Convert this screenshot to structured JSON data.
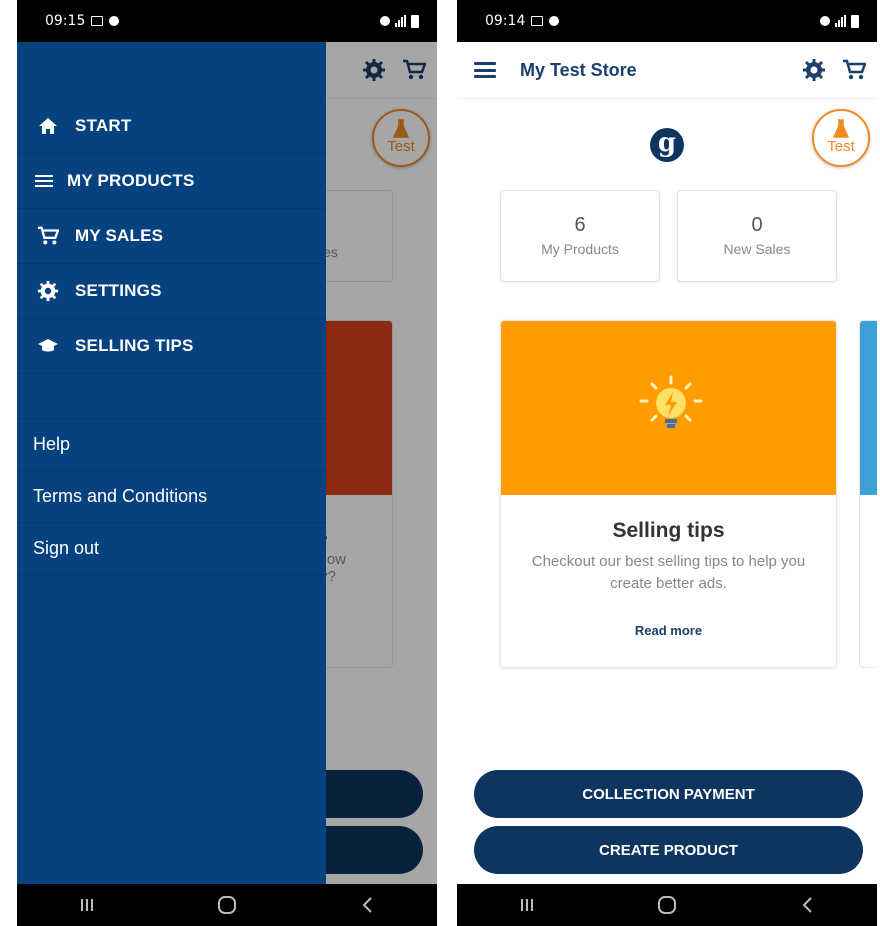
{
  "left": {
    "status": {
      "time": "09:15"
    },
    "drawer": {
      "menu": [
        {
          "label": "START",
          "icon": "home-icon"
        },
        {
          "label": "MY PRODUCTS",
          "icon": "list-icon"
        },
        {
          "label": "MY SALES",
          "icon": "cart-icon"
        },
        {
          "label": "SETTINGS",
          "icon": "gear-icon"
        },
        {
          "label": "SELLING TIPS",
          "icon": "graduation-cap-icon"
        }
      ],
      "links": [
        "Help",
        "Terms and Conditions",
        "Sign out"
      ]
    },
    "behind": {
      "badge": "Test",
      "stat_fragment": "les",
      "tip_title_fragment": "s",
      "tip_text_fragment_1": "How",
      "tip_text_fragment_2": "ty?"
    }
  },
  "right": {
    "status": {
      "time": "09:14"
    },
    "appbar": {
      "title": "My Test Store"
    },
    "badge": {
      "label": "Test"
    },
    "stats": [
      {
        "value": "6",
        "label": "My Products"
      },
      {
        "value": "0",
        "label": "New Sales"
      }
    ],
    "tip_card": {
      "title": "Selling tips",
      "text": "Checkout our best selling tips to help you create better ads.",
      "link": "Read more"
    },
    "buttons": {
      "collection": "COLLECTION PAYMENT",
      "create": "CREATE PRODUCT"
    }
  },
  "colors": {
    "primary": "#0d3560",
    "drawer": "#06427f",
    "accent_orange": "#ff9d00",
    "badge_orange": "#f08a24"
  }
}
